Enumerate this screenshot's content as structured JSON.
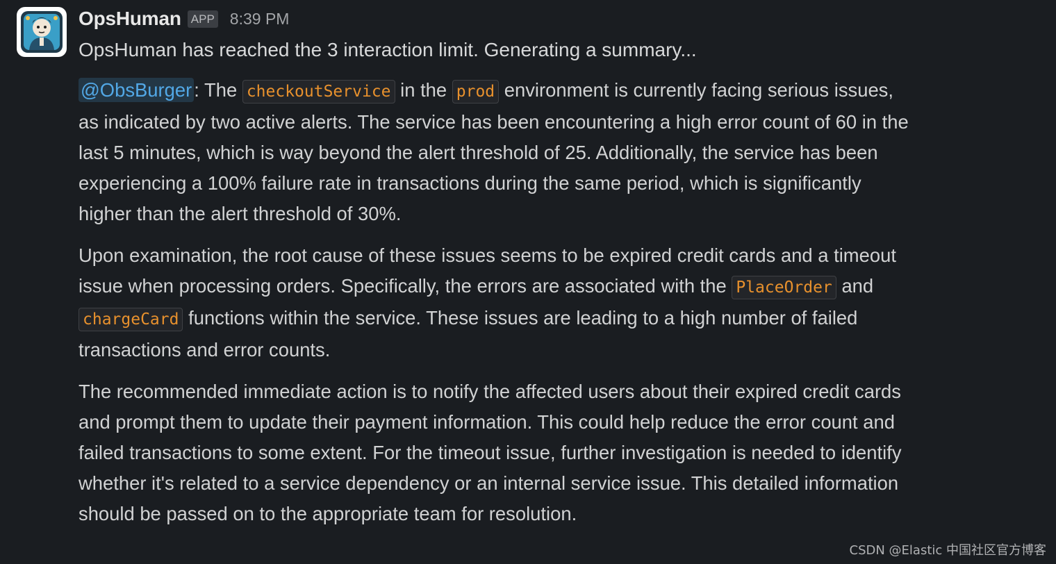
{
  "message": {
    "sender": "OpsHuman",
    "badge": "APP",
    "time": "8:39 PM",
    "first_line": "OpsHuman has reached the 3 interaction limit. Generating a summary...",
    "avatar_icon": "robot-engineer-avatar",
    "paragraph1": {
      "mention": "@ObsBurger",
      "t1": ": The ",
      "code1": "checkoutService",
      "t2": " in the ",
      "code2": "prod",
      "t3": " environment is currently facing serious issues, as indicated by two active alerts. The service has been encountering a high error count of 60 in the last 5 minutes, which is way beyond the alert threshold of 25. Additionally, the service has been experiencing a 100% failure rate in transactions during the same period, which is significantly higher than the alert threshold of 30%."
    },
    "paragraph2": {
      "t1": "Upon examination, the root cause of these issues seems to be expired credit cards and a timeout issue when processing orders. Specifically, the errors are associated with the ",
      "code1": "PlaceOrder",
      "t2": " and ",
      "code2": "chargeCard",
      "t3": " functions within the service. These issues are leading to a high number of failed transactions and error counts."
    },
    "paragraph3": "The recommended immediate action is to notify the affected users about their expired credit cards and prompt them to update their payment information. This could help reduce the error count and failed transactions to some extent. For the timeout issue, further investigation is needed to identify whether it's related to a service dependency or an internal service issue. This detailed information should be passed on to the appropriate team for resolution."
  },
  "watermark": "CSDN @Elastic 中国社区官方博客",
  "colors": {
    "background": "#1a1d21",
    "text": "#d1d2d3",
    "mention": "#52a8e6",
    "code": "#e8912d"
  }
}
